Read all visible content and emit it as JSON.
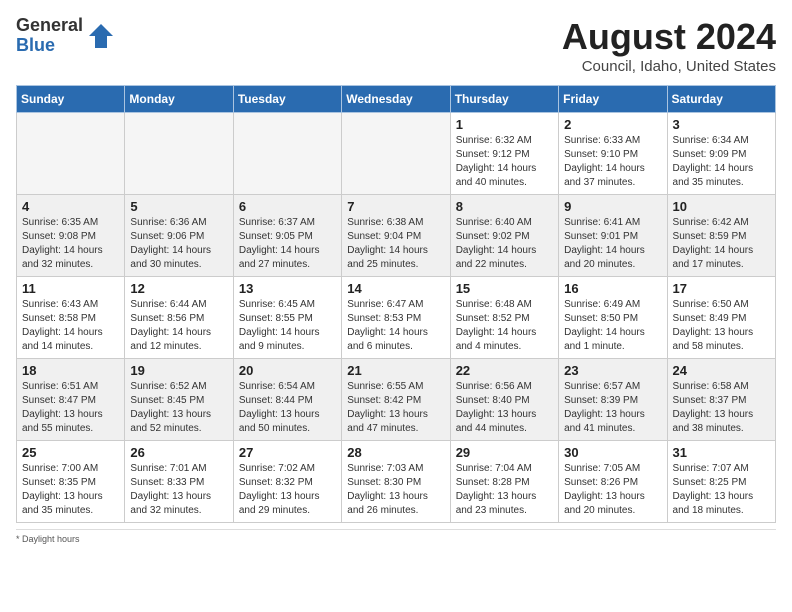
{
  "logo": {
    "general": "General",
    "blue": "Blue"
  },
  "title": "August 2024",
  "location": "Council, Idaho, United States",
  "days_of_week": [
    "Sunday",
    "Monday",
    "Tuesday",
    "Wednesday",
    "Thursday",
    "Friday",
    "Saturday"
  ],
  "daylight_label": "Daylight hours",
  "weeks": [
    [
      {
        "day": "",
        "empty": true
      },
      {
        "day": "",
        "empty": true
      },
      {
        "day": "",
        "empty": true
      },
      {
        "day": "",
        "empty": true
      },
      {
        "day": "1",
        "sunrise": "6:32 AM",
        "sunset": "9:12 PM",
        "daylight": "14 hours and 40 minutes."
      },
      {
        "day": "2",
        "sunrise": "6:33 AM",
        "sunset": "9:10 PM",
        "daylight": "14 hours and 37 minutes."
      },
      {
        "day": "3",
        "sunrise": "6:34 AM",
        "sunset": "9:09 PM",
        "daylight": "14 hours and 35 minutes."
      }
    ],
    [
      {
        "day": "4",
        "sunrise": "6:35 AM",
        "sunset": "9:08 PM",
        "daylight": "14 hours and 32 minutes."
      },
      {
        "day": "5",
        "sunrise": "6:36 AM",
        "sunset": "9:06 PM",
        "daylight": "14 hours and 30 minutes."
      },
      {
        "day": "6",
        "sunrise": "6:37 AM",
        "sunset": "9:05 PM",
        "daylight": "14 hours and 27 minutes."
      },
      {
        "day": "7",
        "sunrise": "6:38 AM",
        "sunset": "9:04 PM",
        "daylight": "14 hours and 25 minutes."
      },
      {
        "day": "8",
        "sunrise": "6:40 AM",
        "sunset": "9:02 PM",
        "daylight": "14 hours and 22 minutes."
      },
      {
        "day": "9",
        "sunrise": "6:41 AM",
        "sunset": "9:01 PM",
        "daylight": "14 hours and 20 minutes."
      },
      {
        "day": "10",
        "sunrise": "6:42 AM",
        "sunset": "8:59 PM",
        "daylight": "14 hours and 17 minutes."
      }
    ],
    [
      {
        "day": "11",
        "sunrise": "6:43 AM",
        "sunset": "8:58 PM",
        "daylight": "14 hours and 14 minutes."
      },
      {
        "day": "12",
        "sunrise": "6:44 AM",
        "sunset": "8:56 PM",
        "daylight": "14 hours and 12 minutes."
      },
      {
        "day": "13",
        "sunrise": "6:45 AM",
        "sunset": "8:55 PM",
        "daylight": "14 hours and 9 minutes."
      },
      {
        "day": "14",
        "sunrise": "6:47 AM",
        "sunset": "8:53 PM",
        "daylight": "14 hours and 6 minutes."
      },
      {
        "day": "15",
        "sunrise": "6:48 AM",
        "sunset": "8:52 PM",
        "daylight": "14 hours and 4 minutes."
      },
      {
        "day": "16",
        "sunrise": "6:49 AM",
        "sunset": "8:50 PM",
        "daylight": "14 hours and 1 minute."
      },
      {
        "day": "17",
        "sunrise": "6:50 AM",
        "sunset": "8:49 PM",
        "daylight": "13 hours and 58 minutes."
      }
    ],
    [
      {
        "day": "18",
        "sunrise": "6:51 AM",
        "sunset": "8:47 PM",
        "daylight": "13 hours and 55 minutes."
      },
      {
        "day": "19",
        "sunrise": "6:52 AM",
        "sunset": "8:45 PM",
        "daylight": "13 hours and 52 minutes."
      },
      {
        "day": "20",
        "sunrise": "6:54 AM",
        "sunset": "8:44 PM",
        "daylight": "13 hours and 50 minutes."
      },
      {
        "day": "21",
        "sunrise": "6:55 AM",
        "sunset": "8:42 PM",
        "daylight": "13 hours and 47 minutes."
      },
      {
        "day": "22",
        "sunrise": "6:56 AM",
        "sunset": "8:40 PM",
        "daylight": "13 hours and 44 minutes."
      },
      {
        "day": "23",
        "sunrise": "6:57 AM",
        "sunset": "8:39 PM",
        "daylight": "13 hours and 41 minutes."
      },
      {
        "day": "24",
        "sunrise": "6:58 AM",
        "sunset": "8:37 PM",
        "daylight": "13 hours and 38 minutes."
      }
    ],
    [
      {
        "day": "25",
        "sunrise": "7:00 AM",
        "sunset": "8:35 PM",
        "daylight": "13 hours and 35 minutes."
      },
      {
        "day": "26",
        "sunrise": "7:01 AM",
        "sunset": "8:33 PM",
        "daylight": "13 hours and 32 minutes."
      },
      {
        "day": "27",
        "sunrise": "7:02 AM",
        "sunset": "8:32 PM",
        "daylight": "13 hours and 29 minutes."
      },
      {
        "day": "28",
        "sunrise": "7:03 AM",
        "sunset": "8:30 PM",
        "daylight": "13 hours and 26 minutes."
      },
      {
        "day": "29",
        "sunrise": "7:04 AM",
        "sunset": "8:28 PM",
        "daylight": "13 hours and 23 minutes."
      },
      {
        "day": "30",
        "sunrise": "7:05 AM",
        "sunset": "8:26 PM",
        "daylight": "13 hours and 20 minutes."
      },
      {
        "day": "31",
        "sunrise": "7:07 AM",
        "sunset": "8:25 PM",
        "daylight": "13 hours and 18 minutes."
      }
    ]
  ]
}
